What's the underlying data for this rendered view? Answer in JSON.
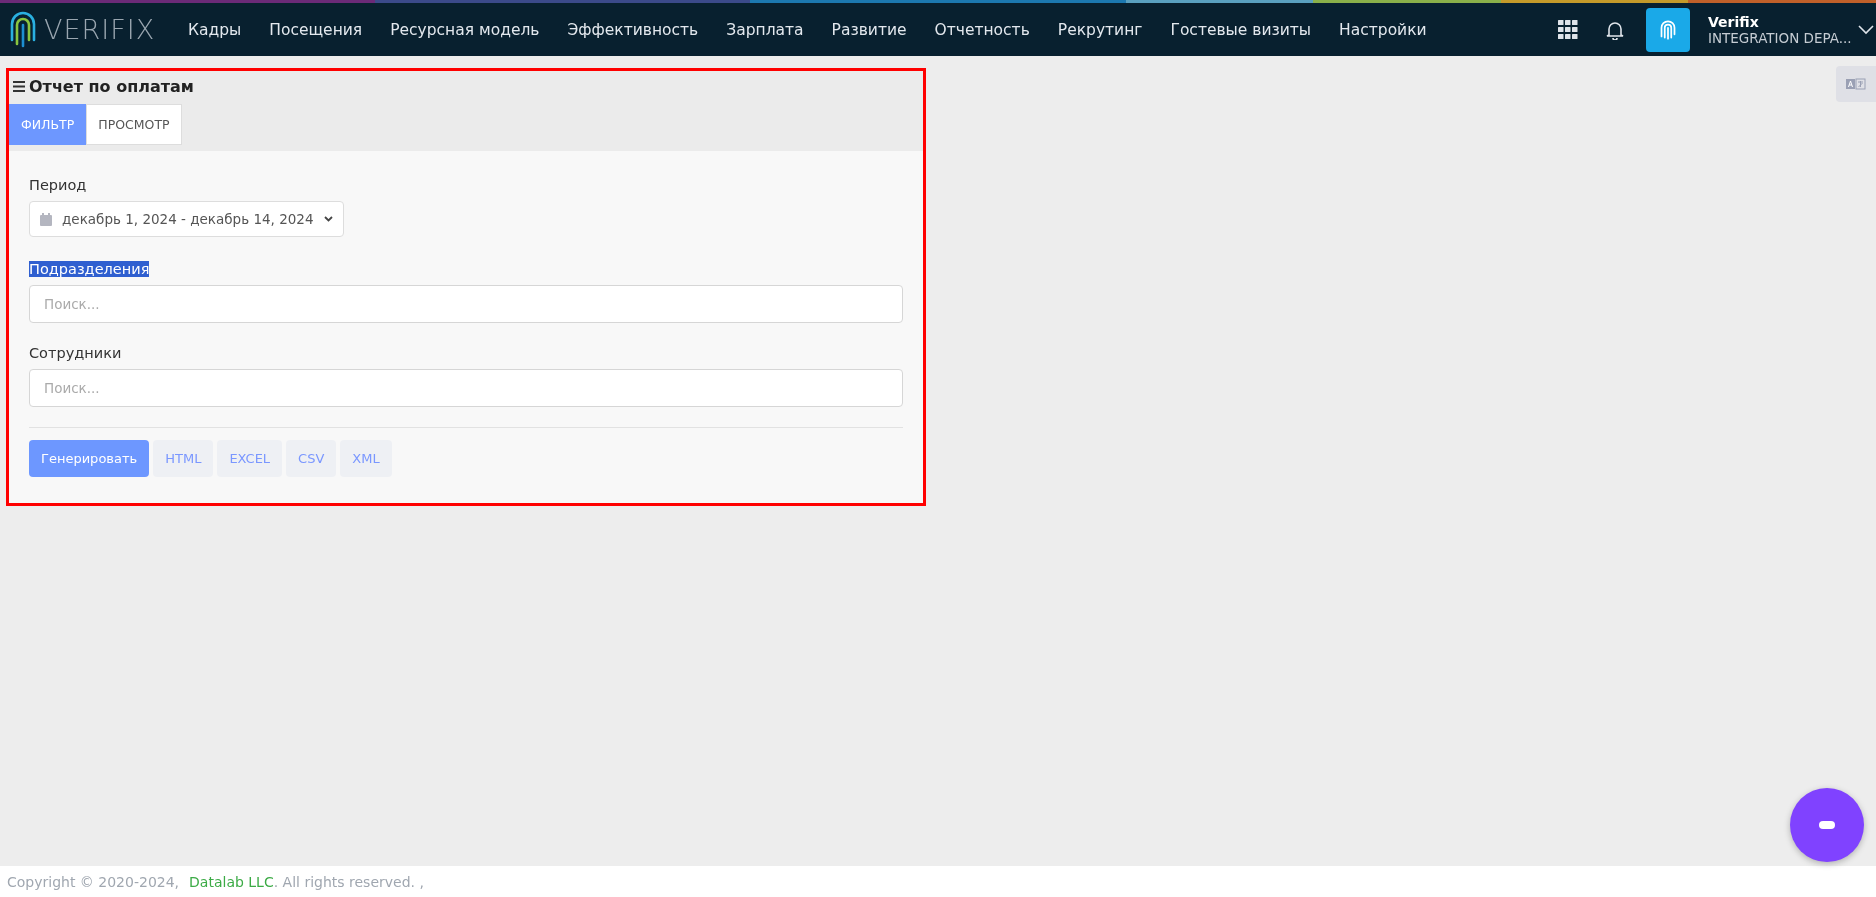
{
  "header": {
    "logo": "VERIFIX",
    "nav": [
      "Кадры",
      "Посещения",
      "Ресурсная модель",
      "Эффективность",
      "Зарплата",
      "Развитие",
      "Отчетность",
      "Рекрутинг",
      "Гостевые визиты",
      "Настройки"
    ],
    "user": {
      "name": "Verifix",
      "department": "INTEGRATION DEPA..."
    }
  },
  "report": {
    "title": "Отчет по оплатам",
    "tabs": [
      {
        "label": "ФИЛЬТР",
        "selected": true
      },
      {
        "label": "ПРОСМОТР",
        "selected": false
      }
    ],
    "period": {
      "label": "Период",
      "value": "декабрь 1, 2024 - декабрь 14, 2024"
    },
    "fields": [
      {
        "label": "Подразделения",
        "highlighted": true,
        "placeholder": "Поиск..."
      },
      {
        "label": "Сотрудники",
        "highlighted": false,
        "placeholder": "Поиск..."
      }
    ],
    "buttons": [
      {
        "label": "Генерировать",
        "kind": "primary"
      },
      {
        "label": "HTML",
        "kind": "export"
      },
      {
        "label": "EXCEL",
        "kind": "export"
      },
      {
        "label": "CSV",
        "kind": "export"
      },
      {
        "label": "XML",
        "kind": "export"
      }
    ]
  },
  "footer": {
    "copyright": "Copyright © 2020-2024,",
    "company": "Datalab LLC",
    "rights": ". All rights reserved. ,"
  }
}
